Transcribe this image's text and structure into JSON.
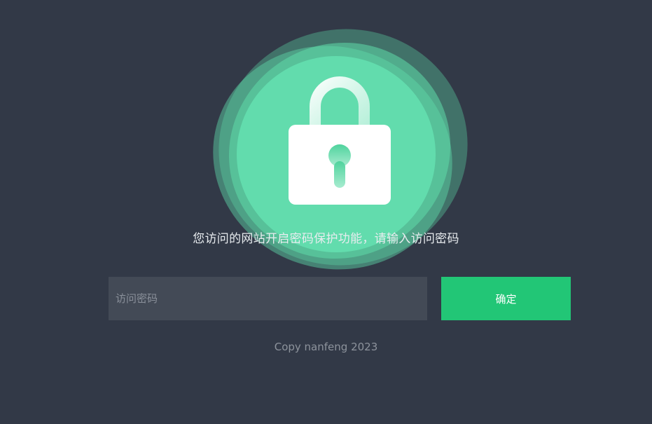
{
  "hero": {
    "icon": "lock-icon",
    "message": "您访问的网站开启密码保护功能，请输入访问密码"
  },
  "form": {
    "password_placeholder": "访问密码",
    "password_value": "",
    "submit_label": "确定"
  },
  "footer": {
    "copyright": "Copy nanfeng 2023"
  },
  "colors": {
    "background": "#323947",
    "accent": "#22c676",
    "blob": "#5fdcaa",
    "input_bg": "#434a56"
  }
}
